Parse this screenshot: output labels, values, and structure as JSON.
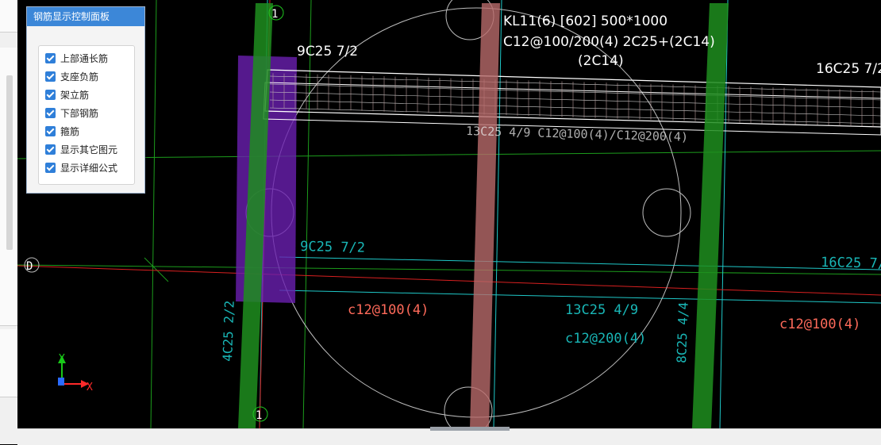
{
  "panel": {
    "title": "钢筋显示控制面板",
    "options": [
      {
        "label": "上部通长筋",
        "checked": true
      },
      {
        "label": "支座负筋",
        "checked": true
      },
      {
        "label": "架立筋",
        "checked": true
      },
      {
        "label": "下部钢筋",
        "checked": true
      },
      {
        "label": "箍筋",
        "checked": true
      },
      {
        "label": "显示其它图元",
        "checked": true
      },
      {
        "label": "显示详细公式",
        "checked": true
      }
    ]
  },
  "canvas": {
    "beam_name": "KL11(6) [602] 500*1000",
    "beam_stirrup": "C12@100/200(4) 2C25+(2C14)",
    "beam_side": "(2C14)",
    "top_left_rebar": "9C25 7/2",
    "top_right_rebar": "16C25 7/2",
    "middle_rebar_label": "13C25 4/9 C12@100(4)/C12@200(4)",
    "cyan_left_rebar": "9C25 7/2",
    "cyan_right_rebar": "16C25 7/",
    "left_stirrup": "c12@100(4)",
    "right_stirrup": "c12@100(4)",
    "mid_bottom_rebar": "13C25 4/9",
    "mid_bottom_stirrup": "c12@200(4)",
    "left_vertical_rebar": "4C25 2/2",
    "right_vertical_rebar": "8C25 4/4",
    "axis_top": "1",
    "axis_bottom": "1",
    "axis_left": "D",
    "ucs_y": "Y",
    "ucs_x": "X"
  },
  "colors": {
    "background": "#000000",
    "panel_title": "#3c87d8",
    "checkbox": "#2f7fd9",
    "column_green": "#1f8e1f",
    "column_red": "#b86a6a",
    "purple_band": "#6a1fb0",
    "cyan_text": "#19b6b6",
    "red_text": "#ff6a5a"
  }
}
